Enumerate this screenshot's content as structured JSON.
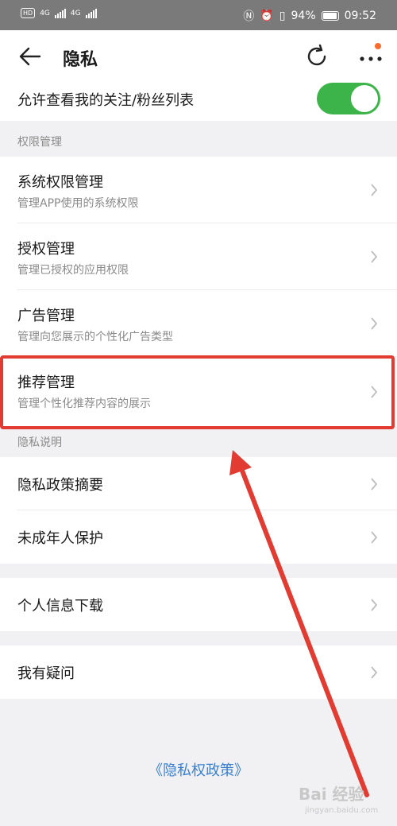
{
  "status": {
    "battery_pct": "94%",
    "time": "09:52",
    "signal1": "4G",
    "signal2": "4G",
    "hd": "HD"
  },
  "appbar": {
    "title": "隐私"
  },
  "toggle_row": {
    "label": "允许查看我的关注/粉丝列表",
    "enabled": true
  },
  "sections": {
    "permissions": "权限管理",
    "privacy": "隐私说明"
  },
  "permission_items": [
    {
      "title": "系统权限管理",
      "subtitle": "管理APP使用的系统权限"
    },
    {
      "title": "授权管理",
      "subtitle": "管理已授权的应用权限"
    },
    {
      "title": "广告管理",
      "subtitle": "管理向您展示的个性化广告类型"
    },
    {
      "title": "推荐管理",
      "subtitle": "管理个性化推荐内容的展示"
    }
  ],
  "privacy_items": [
    {
      "title": "隐私政策摘要"
    },
    {
      "title": "未成年人保护"
    }
  ],
  "download_item": {
    "title": "个人信息下载"
  },
  "question_item": {
    "title": "我有疑问"
  },
  "footer_link": "《隐私权政策》",
  "watermark": {
    "brand": "Bai 经验",
    "url": "jingyan.baidu.com"
  },
  "colors": {
    "toggle_on": "#3cb449",
    "link": "#3a7fd0",
    "highlight": "#e23b32"
  }
}
